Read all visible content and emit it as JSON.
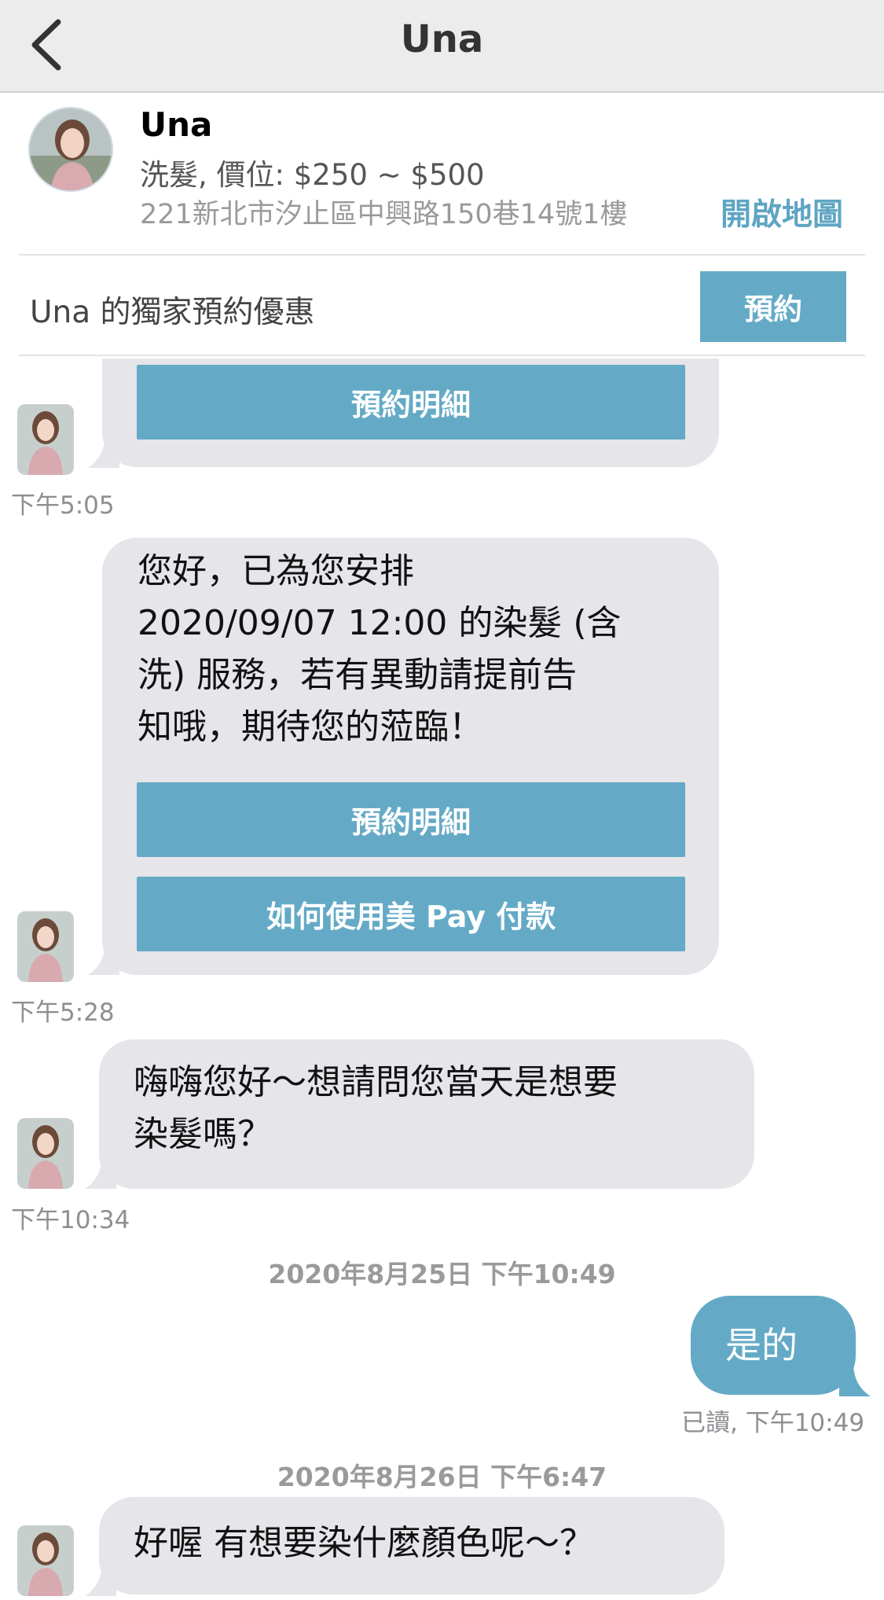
{
  "nav": {
    "title": "Una",
    "back_icon": "chevron-left-icon"
  },
  "profile": {
    "name": "Una",
    "service": "洗髮, 價位: $250 ~ $500",
    "address": "221新北市汐止區中興路150巷14號1樓",
    "map_link": "開啟地圖"
  },
  "promo": {
    "text": "Una 的獨家預約優惠",
    "book_label": "預約"
  },
  "messages": [
    {
      "sender": "Una",
      "button": "預約明細",
      "time": "下午5:05"
    },
    {
      "sender": "Una",
      "text": "您好，已為您安排\n2020/09/07 12:00 的染髮 (含\n洗) 服務，若有異動請提前告\n知哦，期待您的蒞臨！",
      "buttons": [
        "預約明細",
        "如何使用美 Pay 付款"
      ],
      "time": "下午5:28"
    },
    {
      "sender": "Una",
      "text": "嗨嗨您好～想請問您當天是想要\n染髮嗎？",
      "time": "下午10:34"
    },
    {
      "date_separator": "2020年8月25日 下午10:49"
    },
    {
      "sender": "me",
      "text": "是的",
      "time": "已讀, 下午10:49"
    },
    {
      "date_separator": "2020年8月26日 下午6:47"
    },
    {
      "sender": "Una",
      "text": "好喔 有想要染什麼顏色呢～？"
    }
  ],
  "colors": {
    "accent": "#64aac6",
    "bubble_gray": "#e5e5ea",
    "navbar": "#ececec"
  }
}
